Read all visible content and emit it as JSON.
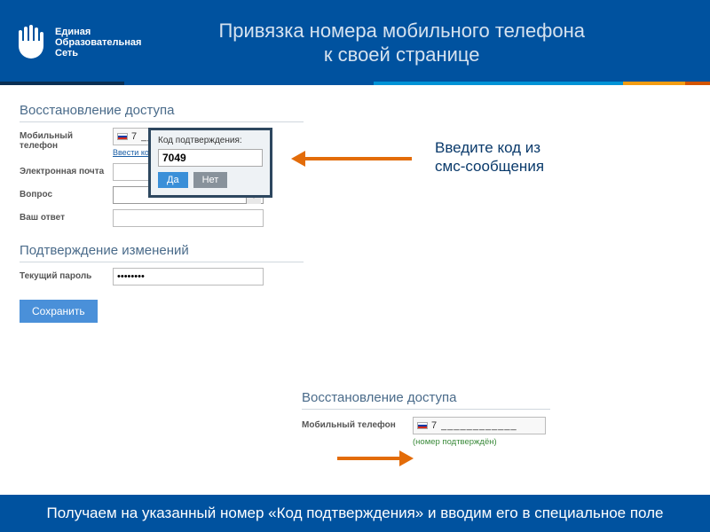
{
  "brand": {
    "name_line1": "Единая",
    "name_line2": "Образовательная",
    "name_line3": "Сеть"
  },
  "header": {
    "title_line1": "Привязка номера мобильного телефона",
    "title_line2": "к своей странице"
  },
  "sections": {
    "restore_title": "Восстановление доступа",
    "confirm_title": "Подтверждение изменений"
  },
  "labels": {
    "mobile": "Мобильный телефон",
    "email": "Электронная почта",
    "question": "Вопрос",
    "answer": "Ваш ответ",
    "current_password": "Текущий пароль"
  },
  "phone": {
    "value": "7 ____________",
    "enter_code_link": "Ввести код подтверждения",
    "confirmed_note": "(номер подтверждён)"
  },
  "popup": {
    "label": "Код подтверждения:",
    "value": "7049",
    "yes": "Да",
    "no": "Нет"
  },
  "form": {
    "email_value": "",
    "answer_value": "",
    "password_masked": "••••••••",
    "save": "Сохранить"
  },
  "callout": {
    "line1": "Введите код из",
    "line2": "смс-сообщения"
  },
  "footer": {
    "text": "Получаем на указанный номер «Код подтверждения» и вводим его в специальное поле"
  },
  "colors": {
    "brand_blue": "#00529f",
    "accent_orange": "#e36c09"
  }
}
